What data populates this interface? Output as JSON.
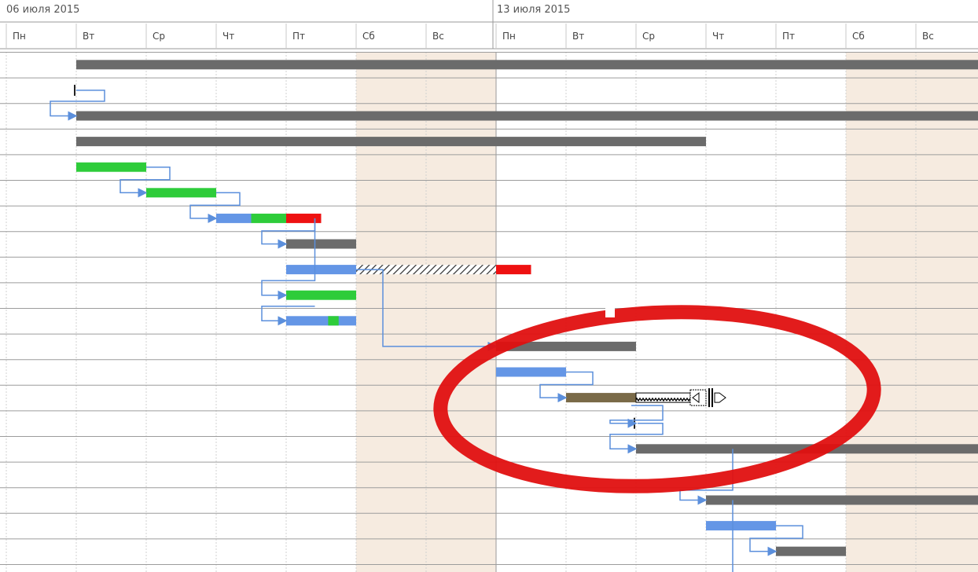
{
  "timeline": {
    "weeks": [
      {
        "label": "06 июля 2015"
      },
      {
        "label": "13 июля 2015"
      }
    ],
    "days": [
      {
        "label": "Пн",
        "weekend": false
      },
      {
        "label": "Вт",
        "weekend": false
      },
      {
        "label": "Ср",
        "weekend": false
      },
      {
        "label": "Чт",
        "weekend": false
      },
      {
        "label": "Пт",
        "weekend": false
      },
      {
        "label": "Сб",
        "weekend": true
      },
      {
        "label": "Вс",
        "weekend": true
      },
      {
        "label": "Пн",
        "weekend": false
      },
      {
        "label": "Вт",
        "weekend": false
      },
      {
        "label": "Ср",
        "weekend": false
      },
      {
        "label": "Чт",
        "weekend": false
      },
      {
        "label": "Пт",
        "weekend": false
      },
      {
        "label": "Сб",
        "weekend": true
      },
      {
        "label": "Вс",
        "weekend": true
      }
    ]
  },
  "colors": {
    "summary": "#6b6b6b",
    "done": "#2ecc3a",
    "planned": "#6496e6",
    "late": "#ee1111",
    "delayed": "#7a6a48",
    "link": "#5b8fdc",
    "weekend": "#f6ebe0",
    "highlight": "#e01010"
  },
  "tasks": [
    {
      "row": 0,
      "kind": "summary",
      "start": 1,
      "end": 14.0
    },
    {
      "row": 1,
      "kind": "milestone",
      "start": 1
    },
    {
      "row": 2,
      "kind": "summary",
      "start": 1,
      "end": 14.0
    },
    {
      "row": 3,
      "kind": "summary",
      "start": 1,
      "end": 10.0
    },
    {
      "row": 4,
      "kind": "done",
      "start": 1,
      "end": 2
    },
    {
      "row": 5,
      "kind": "done",
      "start": 2,
      "end": 3
    },
    {
      "row": 6,
      "kind": "planned",
      "start": 3,
      "end": 3.5,
      "split": [
        {
          "kind": "done",
          "start": 3.5,
          "end": 4
        },
        {
          "kind": "late",
          "start": 4,
          "end": 4.5
        }
      ]
    },
    {
      "row": 7,
      "kind": "summary",
      "start": 4,
      "end": 5
    },
    {
      "row": 8,
      "kind": "planned",
      "start": 4,
      "end": 5,
      "hatch": {
        "start": 5,
        "end": 7
      },
      "split": [
        {
          "kind": "late",
          "start": 7,
          "end": 7.5
        }
      ]
    },
    {
      "row": 9,
      "kind": "done",
      "start": 4,
      "end": 5
    },
    {
      "row": 10,
      "kind": "planned",
      "start": 4,
      "end": 5,
      "split": [
        {
          "kind": "done",
          "start": 4.6,
          "end": 4.75
        }
      ]
    },
    {
      "row": 11,
      "kind": "summary",
      "start": 7,
      "end": 9
    },
    {
      "row": 12,
      "kind": "planned",
      "start": 7,
      "end": 8
    },
    {
      "row": 13,
      "kind": "delayed",
      "start": 8,
      "end": 9,
      "drag": {
        "start": 9,
        "end": 10
      }
    },
    {
      "row": 14,
      "kind": "milestone",
      "start": 9
    },
    {
      "row": 15,
      "kind": "summary",
      "start": 9,
      "end": 14.0
    },
    {
      "row": 17,
      "kind": "summary",
      "start": 10,
      "end": 14.0
    },
    {
      "row": 18,
      "kind": "planned",
      "start": 10,
      "end": 11
    },
    {
      "row": 19,
      "kind": "summary",
      "start": 11,
      "end": 12
    }
  ]
}
